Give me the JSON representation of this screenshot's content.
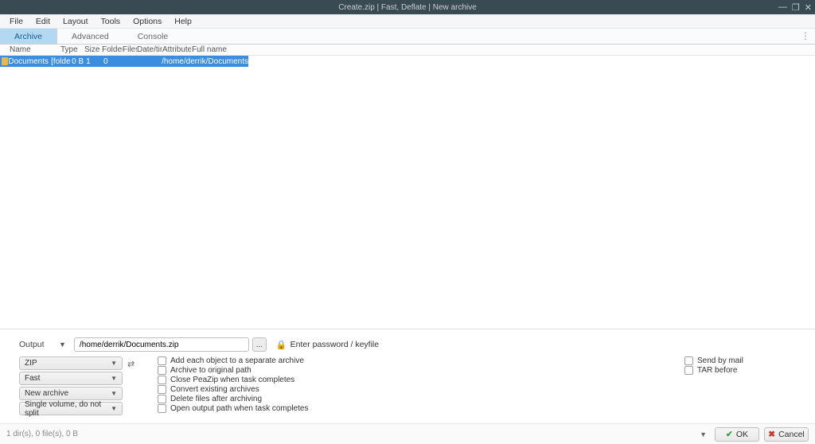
{
  "titlebar": {
    "title": "Create.zip | Fast, Deflate | New archive"
  },
  "menubar": {
    "items": [
      "File",
      "Edit",
      "Layout",
      "Tools",
      "Options",
      "Help"
    ]
  },
  "tabs": {
    "items": [
      "Archive",
      "Advanced",
      "Console"
    ],
    "active_index": 0
  },
  "table": {
    "headers": [
      "Name",
      "Type",
      "Size",
      "Folders",
      "Files",
      "Date/time",
      "Attributes",
      "Full name"
    ],
    "rows": [
      {
        "name": "Documents",
        "type": "[folder]",
        "size": "0 B",
        "folders": "1",
        "files": "0",
        "datetime": "",
        "attributes": "",
        "fullname": "/home/derrik/Documents"
      }
    ]
  },
  "bottom": {
    "output_label": "Output",
    "output_path": "/home/derrik/Documents.zip",
    "dots": "...",
    "password_label": "Enter password / keyfile",
    "format_combo": "ZIP",
    "level_combo": "Fast",
    "mode_combo": "New archive",
    "split_combo": "Single volume, do not split",
    "checks_mid": [
      "Add each object to a separate archive",
      "Archive to original path",
      "Close PeaZip when task completes",
      "Convert existing archives",
      "Delete files after archiving",
      "Open output path when task completes"
    ],
    "checks_right": [
      "Send by mail",
      "TAR before"
    ]
  },
  "footer": {
    "status": "1 dir(s), 0 file(s), 0 B",
    "ok": "OK",
    "cancel": "Cancel"
  }
}
